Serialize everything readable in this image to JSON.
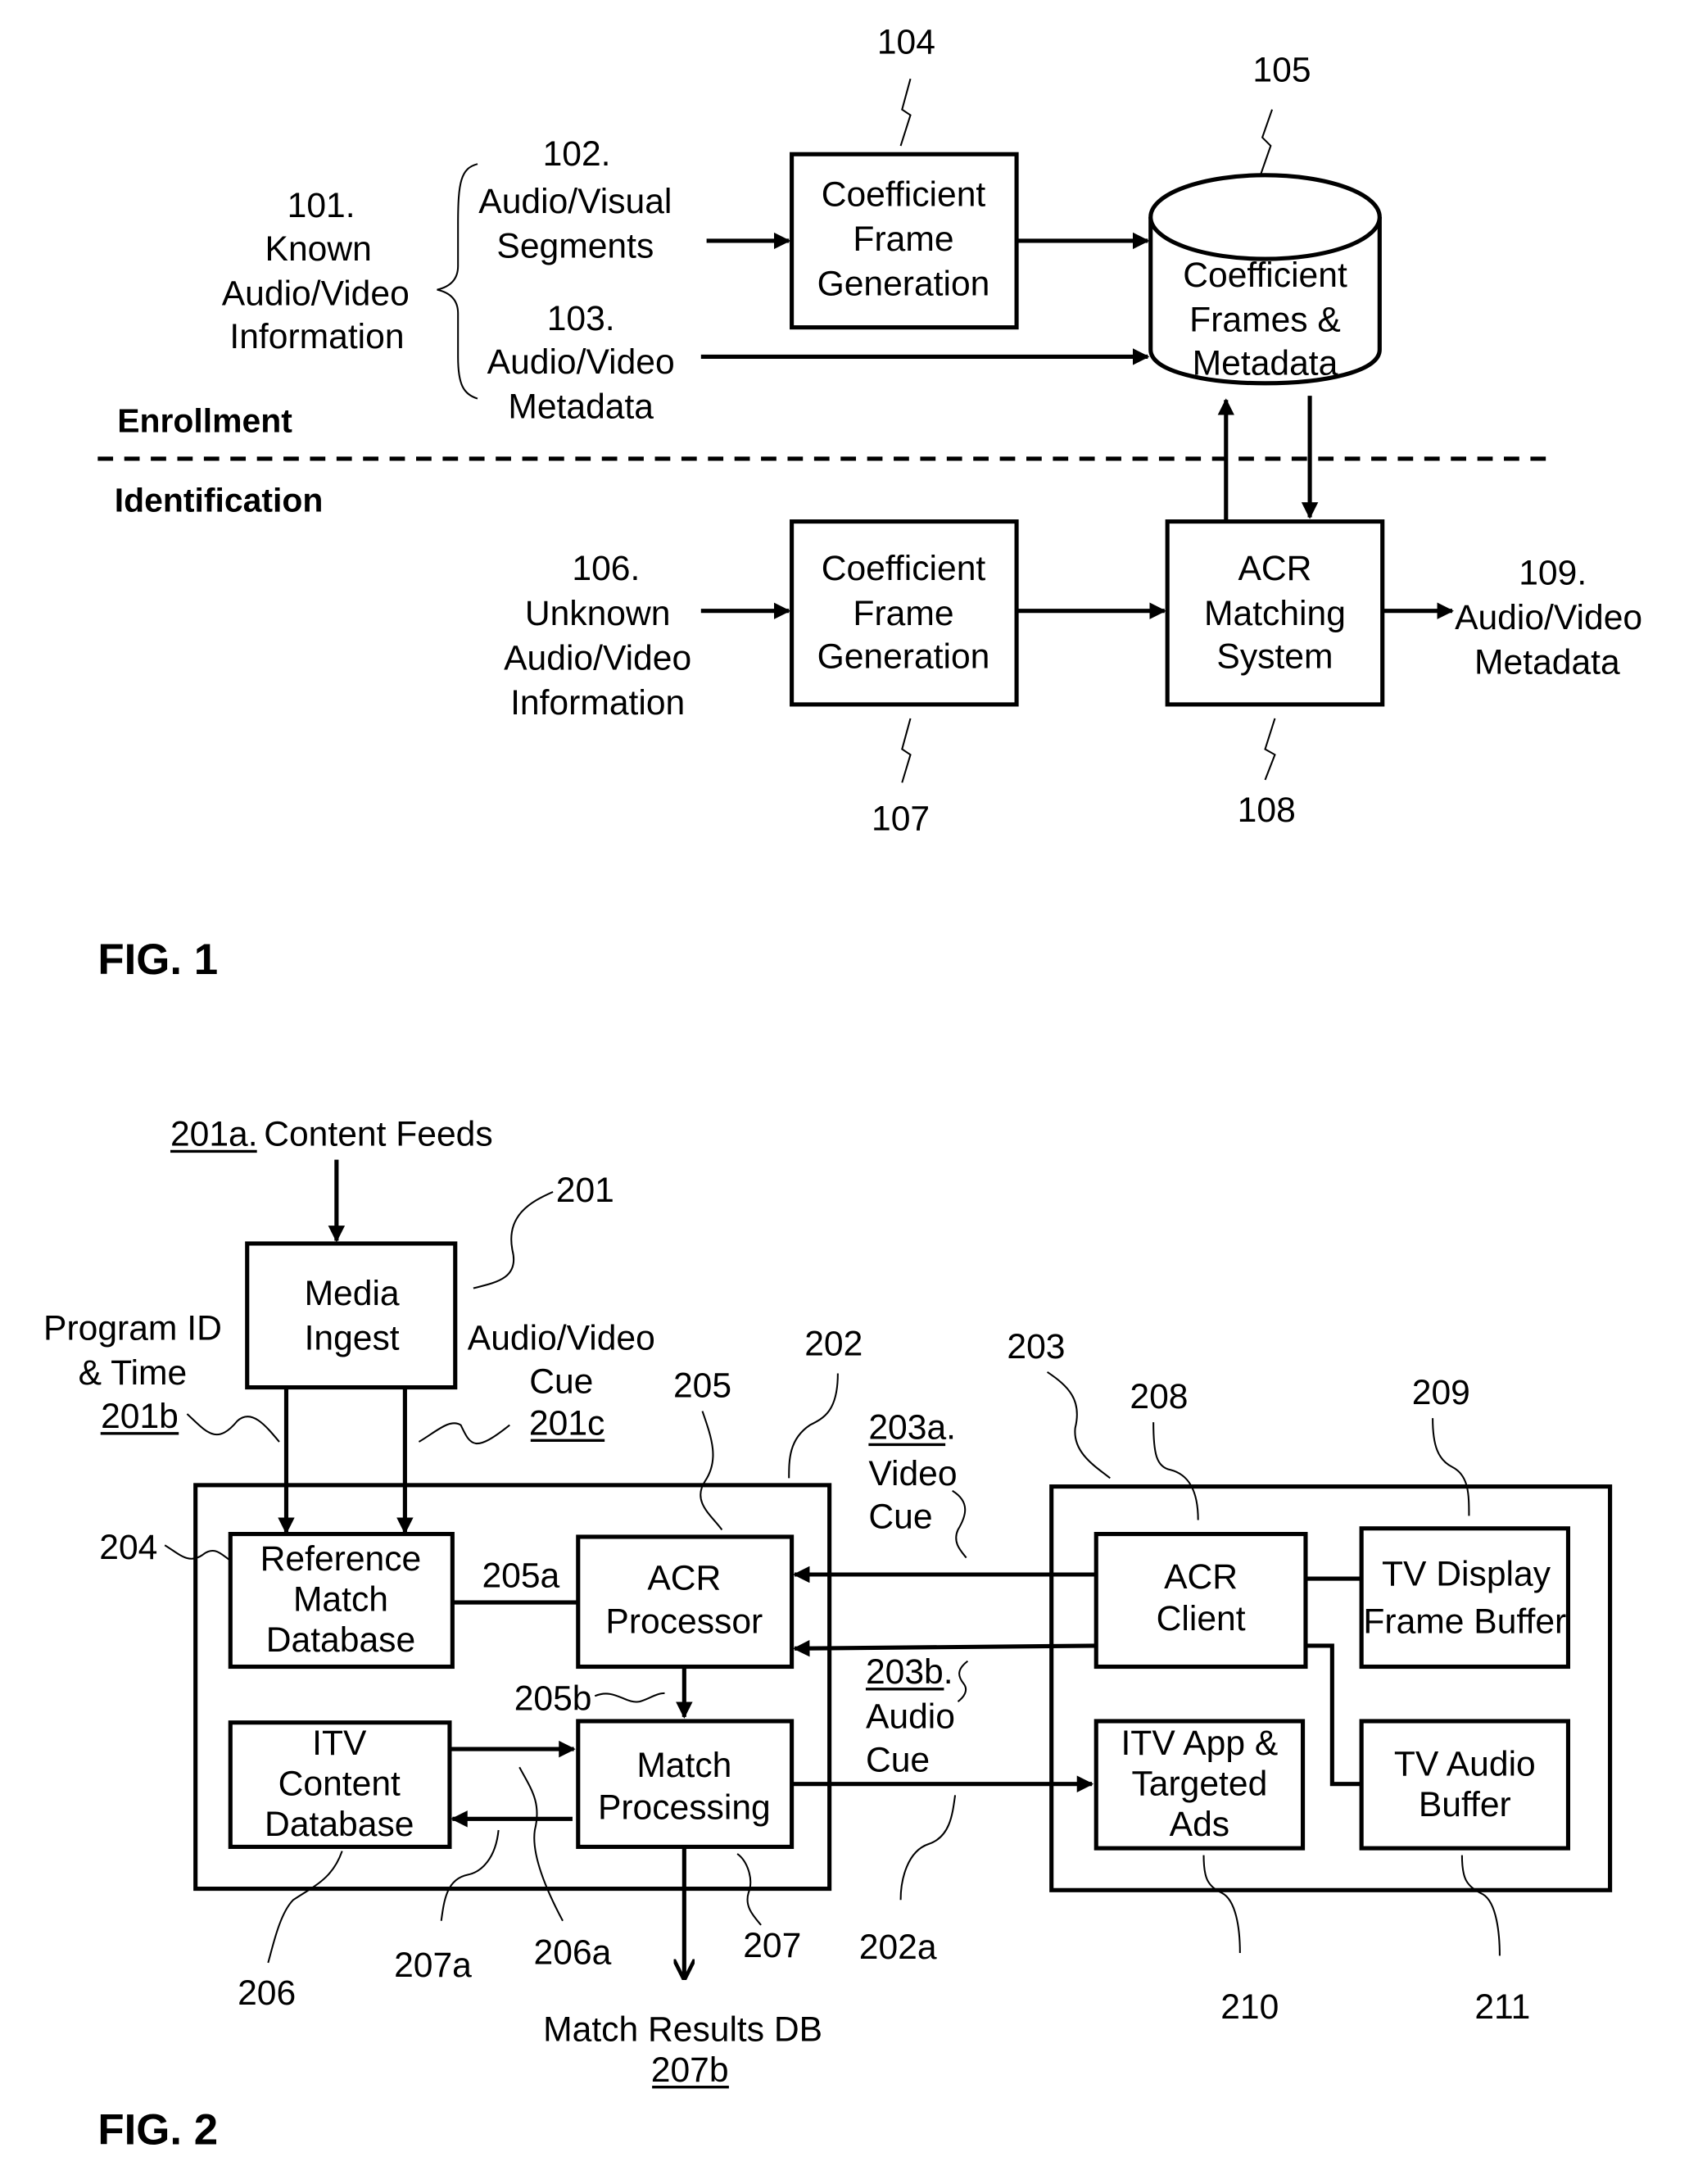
{
  "fig1": {
    "caption": "FIG. 1",
    "section_enrollment": "Enrollment",
    "section_identification": "Identification",
    "known_info": {
      "ref": "101.",
      "lines": [
        "Known",
        "Audio/Video",
        "Information"
      ]
    },
    "av_segments": {
      "ref": "102.",
      "lines": [
        "Audio/Visual",
        "Segments"
      ]
    },
    "av_metadata_in": {
      "ref": "103.",
      "lines": [
        "Audio/Video",
        "Metadata"
      ]
    },
    "coef_gen_top": {
      "ref": "104",
      "lines": [
        "Coefficient",
        "Frame",
        "Generation"
      ]
    },
    "coef_db": {
      "ref": "105",
      "lines": [
        "Coefficient",
        "Frames &",
        "Metadata"
      ]
    },
    "unknown_info": {
      "ref": "106.",
      "lines": [
        "Unknown",
        "Audio/Video",
        "Information"
      ]
    },
    "coef_gen_bottom": {
      "ref": "107",
      "lines": [
        "Coefficient",
        "Frame",
        "Generation"
      ]
    },
    "acr_matching": {
      "ref": "108",
      "lines": [
        "ACR",
        "Matching",
        "System"
      ]
    },
    "av_metadata_out": {
      "ref": "109.",
      "lines": [
        "Audio/Video",
        "Metadata"
      ]
    }
  },
  "fig2": {
    "caption": "FIG. 2",
    "content_feeds": {
      "ref": "201a.",
      "text": "Content Feeds"
    },
    "media_ingest": {
      "ref": "201",
      "lines": [
        "Media",
        "Ingest"
      ]
    },
    "program_id": {
      "lines": [
        "Program ID",
        "& Time"
      ],
      "ref": "201b"
    },
    "av_cue": {
      "lines": [
        "Audio/Video",
        "Cue"
      ],
      "ref": "201c"
    },
    "server_ref": "202",
    "tv_ref": "203",
    "ref_db": {
      "ref": "204",
      "lines": [
        "Reference",
        "Match",
        "Database"
      ]
    },
    "acr_processor": {
      "ref": "205",
      "lines": [
        "ACR",
        "Processor"
      ]
    },
    "link_205a": "205a",
    "link_205b": "205b",
    "itv_db": {
      "ref": "206",
      "lines": [
        "ITV",
        "Content",
        "Database"
      ]
    },
    "link_206a": "206a",
    "match_processing": {
      "ref": "207",
      "lines": [
        "Match",
        "Processing"
      ]
    },
    "link_207a": "207a",
    "match_results": {
      "text": "Match Results DB",
      "ref": "207b"
    },
    "video_cue": {
      "ref": "203a",
      "dot": ".",
      "lines": [
        "Video",
        "Cue"
      ]
    },
    "audio_cue": {
      "ref": "203b",
      "dot": ".",
      "lines": [
        "Audio",
        "Cue"
      ]
    },
    "link_202a": "202a",
    "acr_client": {
      "ref": "208",
      "lines": [
        "ACR",
        "Client"
      ]
    },
    "tv_frame_buffer": {
      "ref": "209",
      "lines": [
        "TV Display",
        "Frame Buffer"
      ]
    },
    "itv_app": {
      "ref": "210",
      "lines": [
        "ITV App &",
        "Targeted",
        "Ads"
      ]
    },
    "tv_audio_buffer": {
      "ref": "211",
      "lines": [
        "TV Audio",
        "Buffer"
      ]
    }
  }
}
